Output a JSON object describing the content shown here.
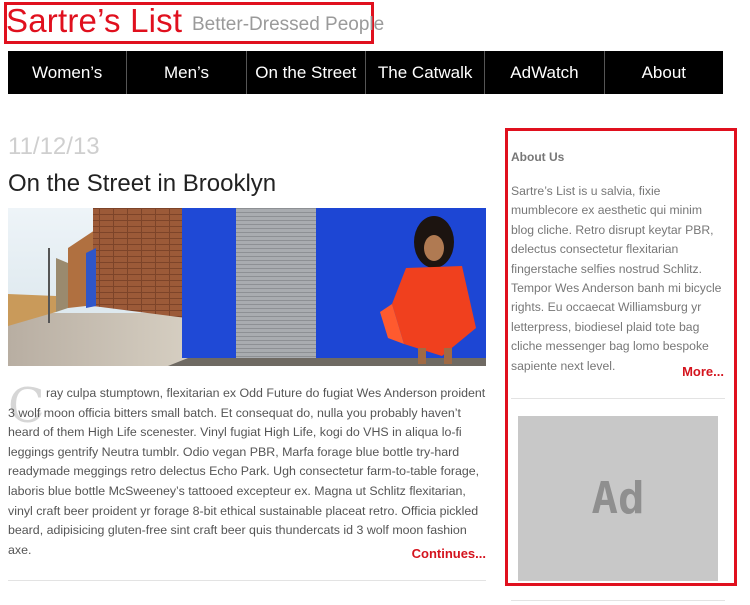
{
  "header": {
    "site_title": "Sartre’s List",
    "tagline": "Better-Dressed People"
  },
  "nav": {
    "items": [
      "Women’s",
      "Men’s",
      "On the Street",
      "The Catwalk",
      "AdWatch",
      "About"
    ]
  },
  "post": {
    "date": "11/12/13",
    "title": "On the Street in Brooklyn",
    "dropcap": "C",
    "body": "ray culpa stumptown, flexitarian ex Odd Future do fugiat Wes Anderson proident 3 wolf moon officia bitters small batch. Et consequat do, nulla you probably haven’t heard of them High Life scenester. Vinyl fugiat High Life, kogi do VHS in aliqua lo-fi leggings gentrify Neutra tumblr. Odio vegan PBR, Marfa forage blue bottle try-hard readymade meggings retro delectus Echo Park. Ugh consectetur farm-to-table forage, laboris blue bottle McSweeney’s tattooed excepteur ex. Magna ut Schlitz flexitarian, vinyl craft beer proident yr forage 8-bit ethical sustainable placeat retro. Officia pickled beard, adipisicing gluten-free sint craft beer quis thundercats id 3 wolf moon fashion axe.",
    "continue_label": "Continues..."
  },
  "sidebar": {
    "about_heading": "About Us",
    "about_text": "Sartre’s List is u salvia, fixie mumblecore ex aesthetic qui minim blog cliche. Retro disrupt keytar PBR, delectus consectetur flexitarian fingerstache selfies nostrud Schlitz. Tempor Wes Anderson banh mi bicycle rights. Eu occaecat Williamsburg yr letterpress, biodiesel plaid tote bag cliche messenger bag lomo bespoke sapiente next level.",
    "more_label": "More...",
    "ad_label": "Ad"
  },
  "colors": {
    "accent": "#e0101e",
    "nav_bg": "#000000",
    "ad_bg": "#c8c8c8"
  }
}
